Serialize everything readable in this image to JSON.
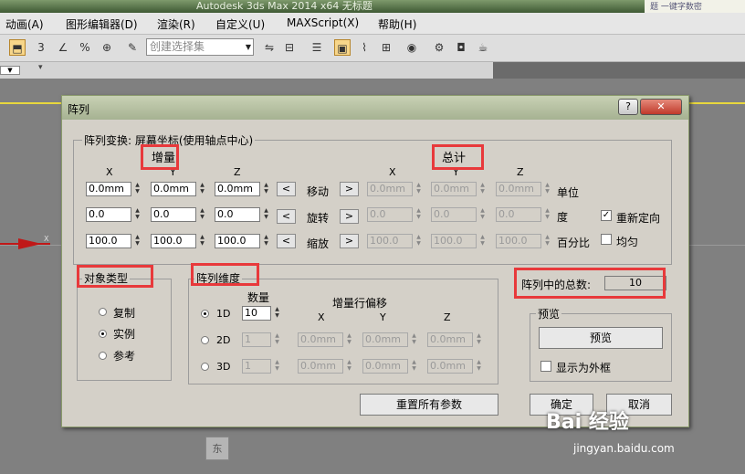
{
  "window": {
    "title": "Autodesk 3ds Max  2014 x64      无标题",
    "tag": "题   一键字数密"
  },
  "menu": [
    "动画(A)",
    "图形编辑器(D)",
    "渲染(R)",
    "自定义(U)",
    "MAXScript(X)",
    "帮助(H)"
  ],
  "toolbar": {
    "selection_set_placeholder": "创建选择集"
  },
  "viewport": {
    "axis_label": "X",
    "viewcube_label": "东"
  },
  "dialog": {
    "title": "阵列",
    "help_label": "?",
    "close_label": "✕",
    "transform_group": "阵列变换: 屏幕坐标(使用轴点中心)",
    "incremental_label": "增量",
    "total_label": "总计",
    "axes": [
      "X",
      "Y",
      "Z"
    ],
    "rows": [
      {
        "name": "移动",
        "inc": [
          "0.0mm",
          "0.0mm",
          "0.0mm"
        ],
        "total": [
          "0.0mm",
          "0.0mm",
          "0.0mm"
        ],
        "unit": "单位"
      },
      {
        "name": "旋转",
        "inc": [
          "0.0",
          "0.0",
          "0.0"
        ],
        "total": [
          "0.0",
          "0.0",
          "0.0"
        ],
        "unit": "度"
      },
      {
        "name": "缩放",
        "inc": [
          "100.0",
          "100.0",
          "100.0"
        ],
        "total": [
          "100.0",
          "100.0",
          "100.0"
        ],
        "unit": "百分比"
      }
    ],
    "arrow_left": "<",
    "arrow_right": ">",
    "reorient_label": "重新定向",
    "reorient_checked": true,
    "uniform_label": "均匀",
    "uniform_checked": false,
    "object_type": {
      "label": "对象类型",
      "options": [
        "复制",
        "实例",
        "参考"
      ],
      "selected": "实例"
    },
    "array_dims": {
      "label": "阵列维度",
      "count_header": "数量",
      "offset_header": "增量行偏移",
      "rows": [
        {
          "dim": "1D",
          "count": "10",
          "offsets": []
        },
        {
          "dim": "2D",
          "count": "1",
          "offsets": [
            "0.0mm",
            "0.0mm",
            "0.0mm"
          ]
        },
        {
          "dim": "3D",
          "count": "1",
          "offsets": [
            "0.0mm",
            "0.0mm",
            "0.0mm"
          ]
        }
      ],
      "selected": "1D"
    },
    "total_count": {
      "label": "阵列中的总数:",
      "value": "10"
    },
    "preview": {
      "label": "预览",
      "button": "预览",
      "show_box_label": "显示为外框",
      "show_box_checked": false
    },
    "reset_button": "重置所有参数",
    "ok_button": "确定",
    "cancel_button": "取消"
  },
  "watermark": {
    "logo": "Bai 经验",
    "url": "jingyan.baidu.com"
  },
  "colors": {
    "highlight_box": "#e8393b",
    "dialog_bg": "#d4d0c8",
    "axis_red": "#c01818"
  }
}
